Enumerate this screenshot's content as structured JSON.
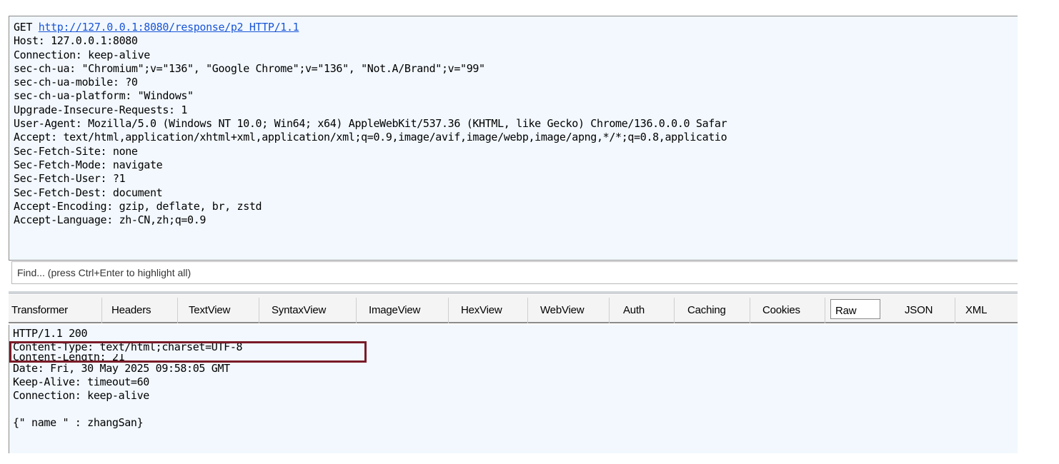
{
  "request": {
    "first_line": {
      "method": "GET",
      "url": "http://127.0.0.1:8080/response/p2 HTTP/1.1"
    },
    "headers": [
      "Host: 127.0.0.1:8080",
      "Connection: keep-alive",
      "sec-ch-ua: \"Chromium\";v=\"136\", \"Google Chrome\";v=\"136\", \"Not.A/Brand\";v=\"99\"",
      "sec-ch-ua-mobile: ?0",
      "sec-ch-ua-platform: \"Windows\"",
      "Upgrade-Insecure-Requests: 1",
      "User-Agent: Mozilla/5.0 (Windows NT 10.0; Win64; x64) AppleWebKit/537.36 (KHTML, like Gecko) Chrome/136.0.0.0 Safar",
      "Accept: text/html,application/xhtml+xml,application/xml;q=0.9,image/avif,image/webp,image/apng,*/*;q=0.8,applicatio",
      "Sec-Fetch-Site: none",
      "Sec-Fetch-Mode: navigate",
      "Sec-Fetch-User: ?1",
      "Sec-Fetch-Dest: document",
      "Accept-Encoding: gzip, deflate, br, zstd",
      "Accept-Language: zh-CN,zh;q=0.9"
    ]
  },
  "find": {
    "placeholder": "Find... (press Ctrl+Enter to highlight all)"
  },
  "tabs": [
    "Transformer",
    "Headers",
    "TextView",
    "SyntaxView",
    "ImageView",
    "HexView",
    "WebView",
    "Auth",
    "Caching",
    "Cookies",
    "Raw",
    "JSON",
    "XML"
  ],
  "active_tab": "Raw",
  "response": {
    "lines": [
      "HTTP/1.1 200",
      "Content-Type: text/html;charset=UTF-8",
      "Content-Length: 21",
      "Date: Fri, 30 May 2025 09:58:05 GMT",
      "Keep-Alive: timeout=60",
      "Connection: keep-alive",
      "",
      "{\" name \" : zhangSan}"
    ]
  },
  "highlight_color": "#7a1b27"
}
